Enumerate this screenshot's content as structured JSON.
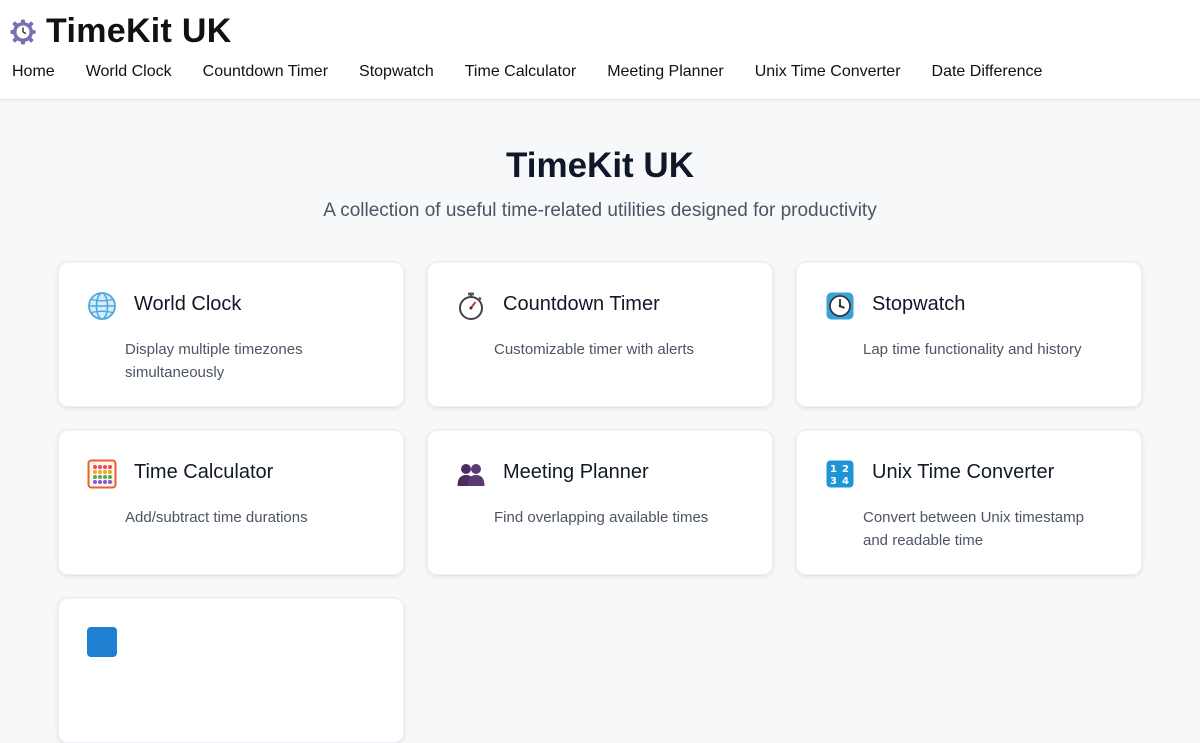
{
  "header": {
    "brand_title": "TimeKit UK",
    "brand_icon": "gear-clock-icon",
    "nav": [
      "Home",
      "World Clock",
      "Countdown Timer",
      "Stopwatch",
      "Time Calculator",
      "Meeting Planner",
      "Unix Time Converter",
      "Date Difference"
    ]
  },
  "hero": {
    "title": "TimeKit UK",
    "subtitle": "A collection of useful time-related utilities designed for productivity"
  },
  "cards": [
    {
      "title": "World Clock",
      "description": "Display multiple timezones simultaneously",
      "icon": "globe-icon"
    },
    {
      "title": "Countdown Timer",
      "description": "Customizable timer with alerts",
      "icon": "stopwatch-icon"
    },
    {
      "title": "Stopwatch",
      "description": "Lap time functionality and history",
      "icon": "clock-icon"
    },
    {
      "title": "Time Calculator",
      "description": "Add/subtract time durations",
      "icon": "abacus-icon"
    },
    {
      "title": "Meeting Planner",
      "description": "Find overlapping available times",
      "icon": "people-icon"
    },
    {
      "title": "Unix Time Converter",
      "description": "Convert between Unix timestamp and readable time",
      "icon": "numbers-icon"
    }
  ],
  "colors": {
    "page_background": "#f7f8fa",
    "card_background": "#ffffff",
    "text_primary": "#111827",
    "text_secondary": "#4b5563"
  }
}
